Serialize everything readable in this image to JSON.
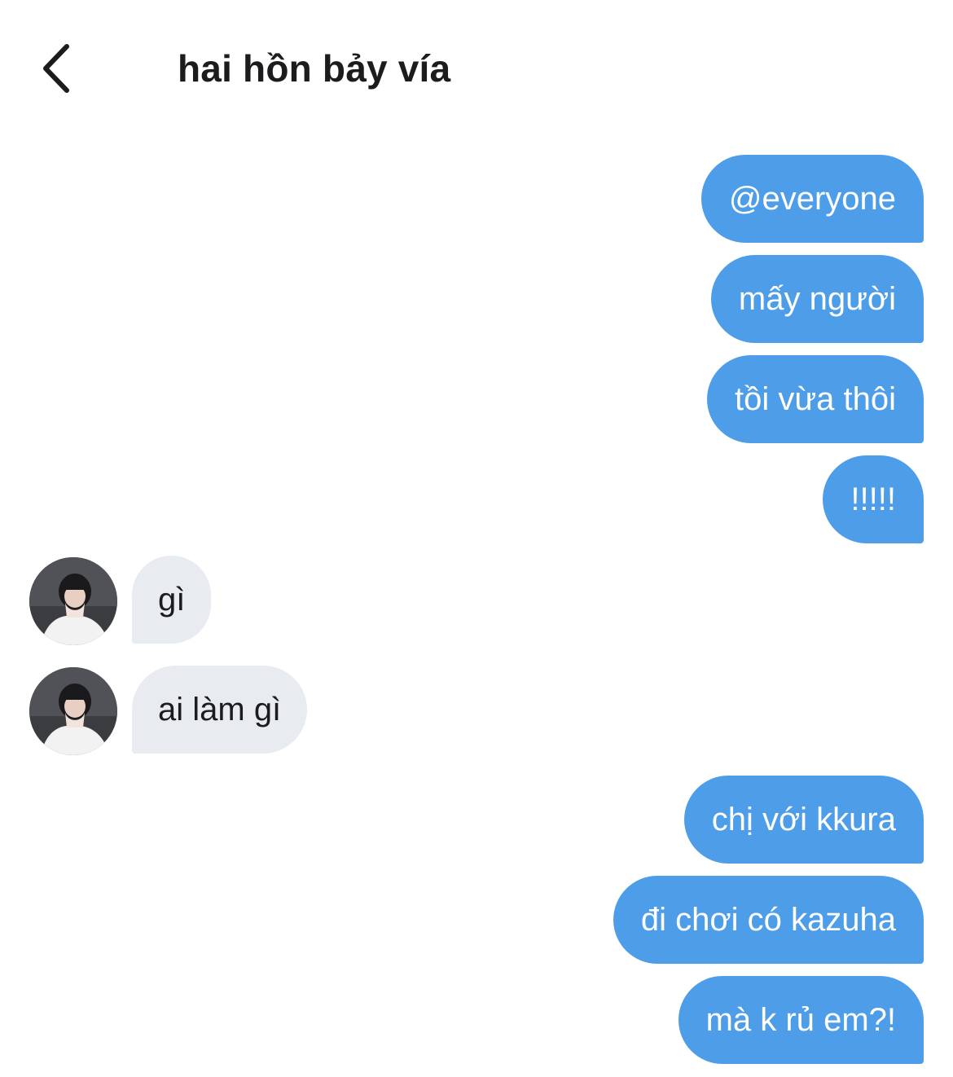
{
  "header": {
    "title": "hai hồn bảy vía",
    "back_icon": "chevron-left-icon"
  },
  "colors": {
    "outgoing_bubble": "#4d9de9",
    "incoming_bubble": "#e8ebf0",
    "outgoing_text": "#ffffff",
    "incoming_text": "#1c1c1e"
  },
  "messages": [
    {
      "direction": "out",
      "text": "@everyone"
    },
    {
      "direction": "out",
      "text": "mấy người"
    },
    {
      "direction": "out",
      "text": "tồi vừa thôi"
    },
    {
      "direction": "out",
      "text": "!!!!!"
    },
    {
      "direction": "in",
      "text": "gì",
      "avatar": "user-avatar"
    },
    {
      "direction": "in",
      "text": "ai làm gì",
      "avatar": "user-avatar"
    },
    {
      "direction": "out",
      "text": "chị với kkura"
    },
    {
      "direction": "out",
      "text": "đi chơi có kazuha"
    },
    {
      "direction": "out",
      "text": "mà k rủ em?!"
    }
  ]
}
